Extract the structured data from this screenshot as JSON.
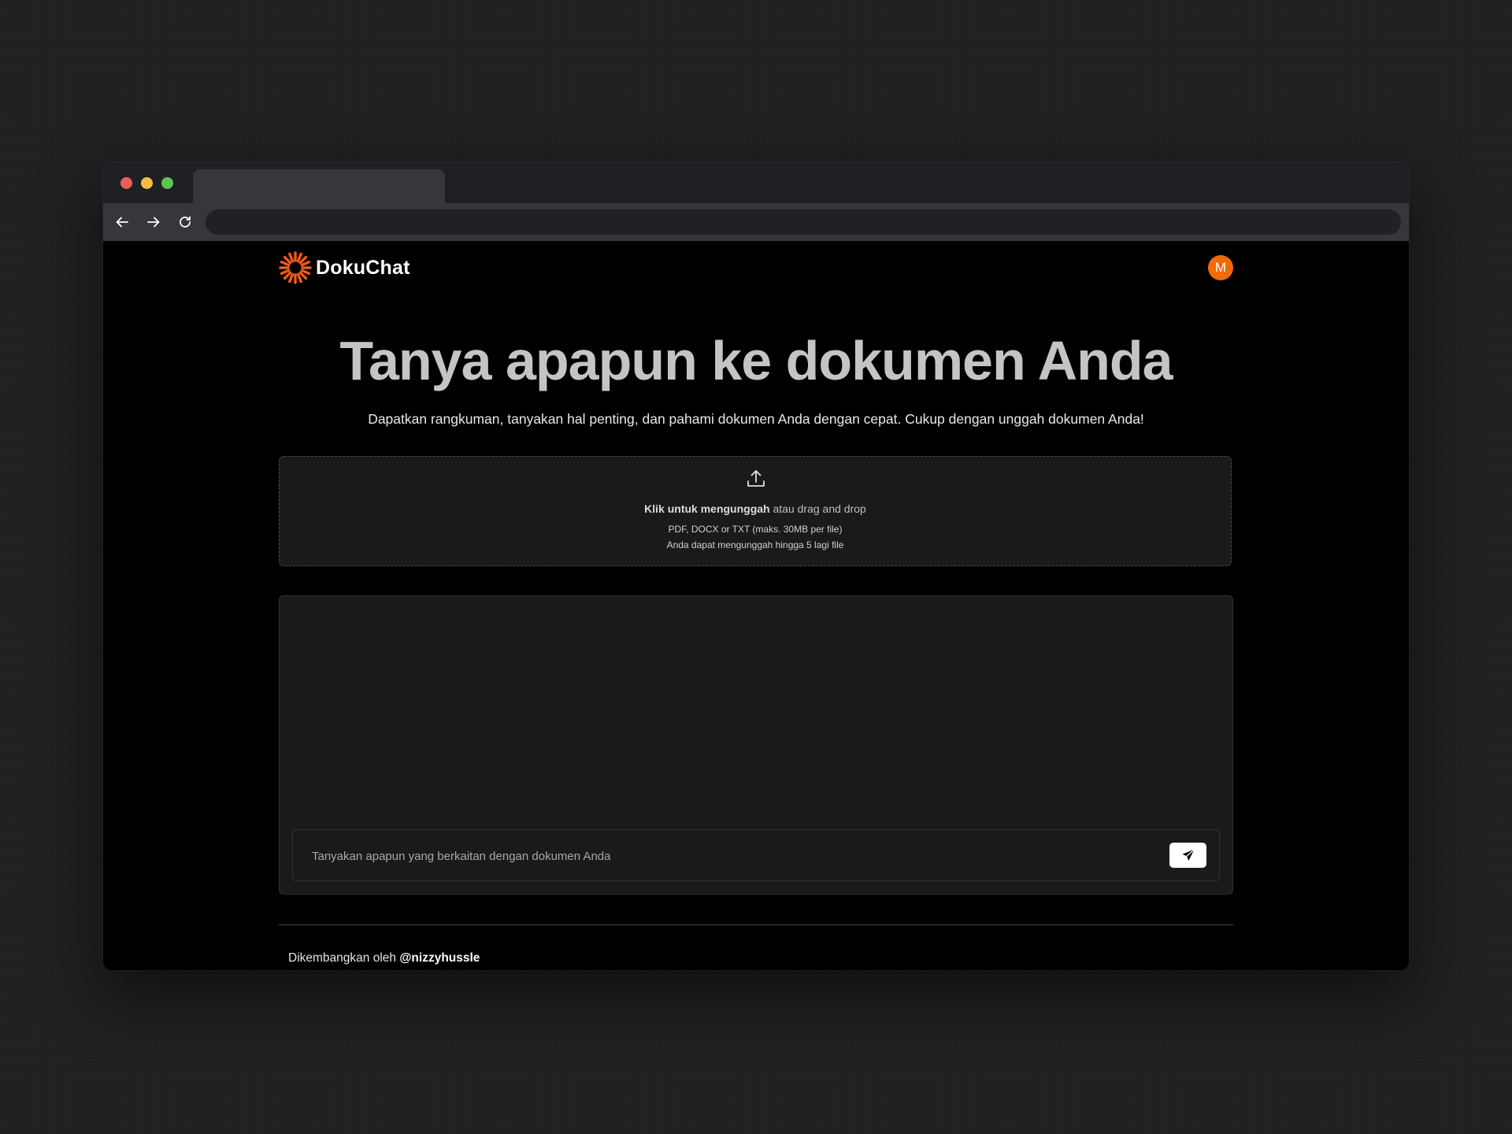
{
  "app": {
    "brand": "DokuChat",
    "user_initial": "M",
    "accent_color": "#f06a0a",
    "logo_color": "#f05a1a"
  },
  "hero": {
    "title": "Tanya apapun ke dokumen Anda",
    "subtitle": "Dapatkan rangkuman, tanyakan hal penting, dan pahami dokumen Anda dengan cepat. Cukup dengan unggah dokumen Anda!"
  },
  "upload": {
    "icon": "upload-icon",
    "click_label": "Klik untuk mengunggah",
    "drag_label": " atau drag and drop",
    "formats": "PDF, DOCX or TXT (maks. 30MB per file)",
    "limit": "Anda dapat mengunggah hingga 5 lagi file"
  },
  "chat": {
    "placeholder": "Tanyakan apapun yang berkaitan dengan dokumen Anda",
    "send_icon": "send-icon"
  },
  "footer": {
    "prefix": "Dikembangkan oleh ",
    "author": "@nizzyhussle"
  },
  "browser": {
    "controls": [
      "close",
      "minimize",
      "maximize"
    ],
    "nav_icons": [
      "back-arrow-icon",
      "forward-arrow-icon",
      "reload-icon"
    ]
  }
}
